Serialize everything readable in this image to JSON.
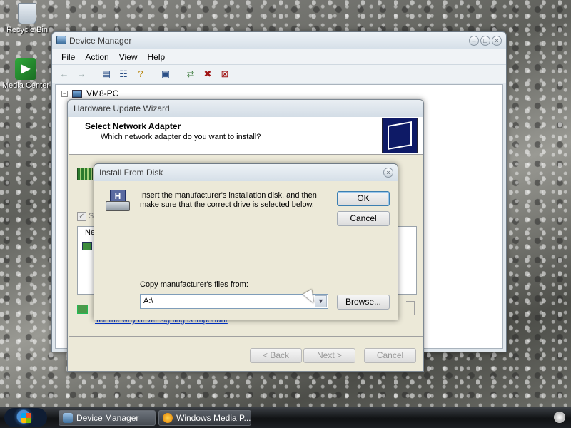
{
  "desktop": {
    "icons": [
      {
        "label": "Recycle Bin"
      },
      {
        "label": "Media Center"
      }
    ]
  },
  "device_manager": {
    "title": "Device Manager",
    "menu": [
      "File",
      "Action",
      "View",
      "Help"
    ],
    "toolbar_icons": [
      "back-arrow-icon",
      "forward-arrow-icon",
      "show-hide-tree-icon",
      "properties-icon",
      "help-icon",
      "scan-hardware-icon",
      "update-driver-icon",
      "disable-device-icon",
      "uninstall-device-icon"
    ],
    "tree_root": "VM8-PC"
  },
  "wizard": {
    "title": "Hardware Update Wizard",
    "header_title": "Select Network Adapter",
    "header_subtitle": "Which network adapter do you want to install?",
    "checkbox_label_partial": "S",
    "list_header_partial": "Ne",
    "link_text": "Tell me why driver signing is important",
    "back_label": "< Back",
    "next_label": "Next >",
    "cancel_label": "Cancel"
  },
  "install_from_disk": {
    "title": "Install From Disk",
    "message": "Insert the manufacturer's installation disk, and then make sure that the correct drive is selected below.",
    "ok_label": "OK",
    "cancel_label": "Cancel",
    "copy_label": "Copy manufacturer's files from:",
    "copy_from_value": "A:\\",
    "browse_label": "Browse..."
  },
  "taskbar": {
    "tasks": [
      {
        "label": "Device Manager",
        "active": true
      },
      {
        "label": "Windows Media P...",
        "active": false
      }
    ]
  },
  "colors": {
    "link": "#0033cc",
    "wizard_logo_bg": "#0e1a66",
    "dialog_bg": "#ece9d8"
  }
}
